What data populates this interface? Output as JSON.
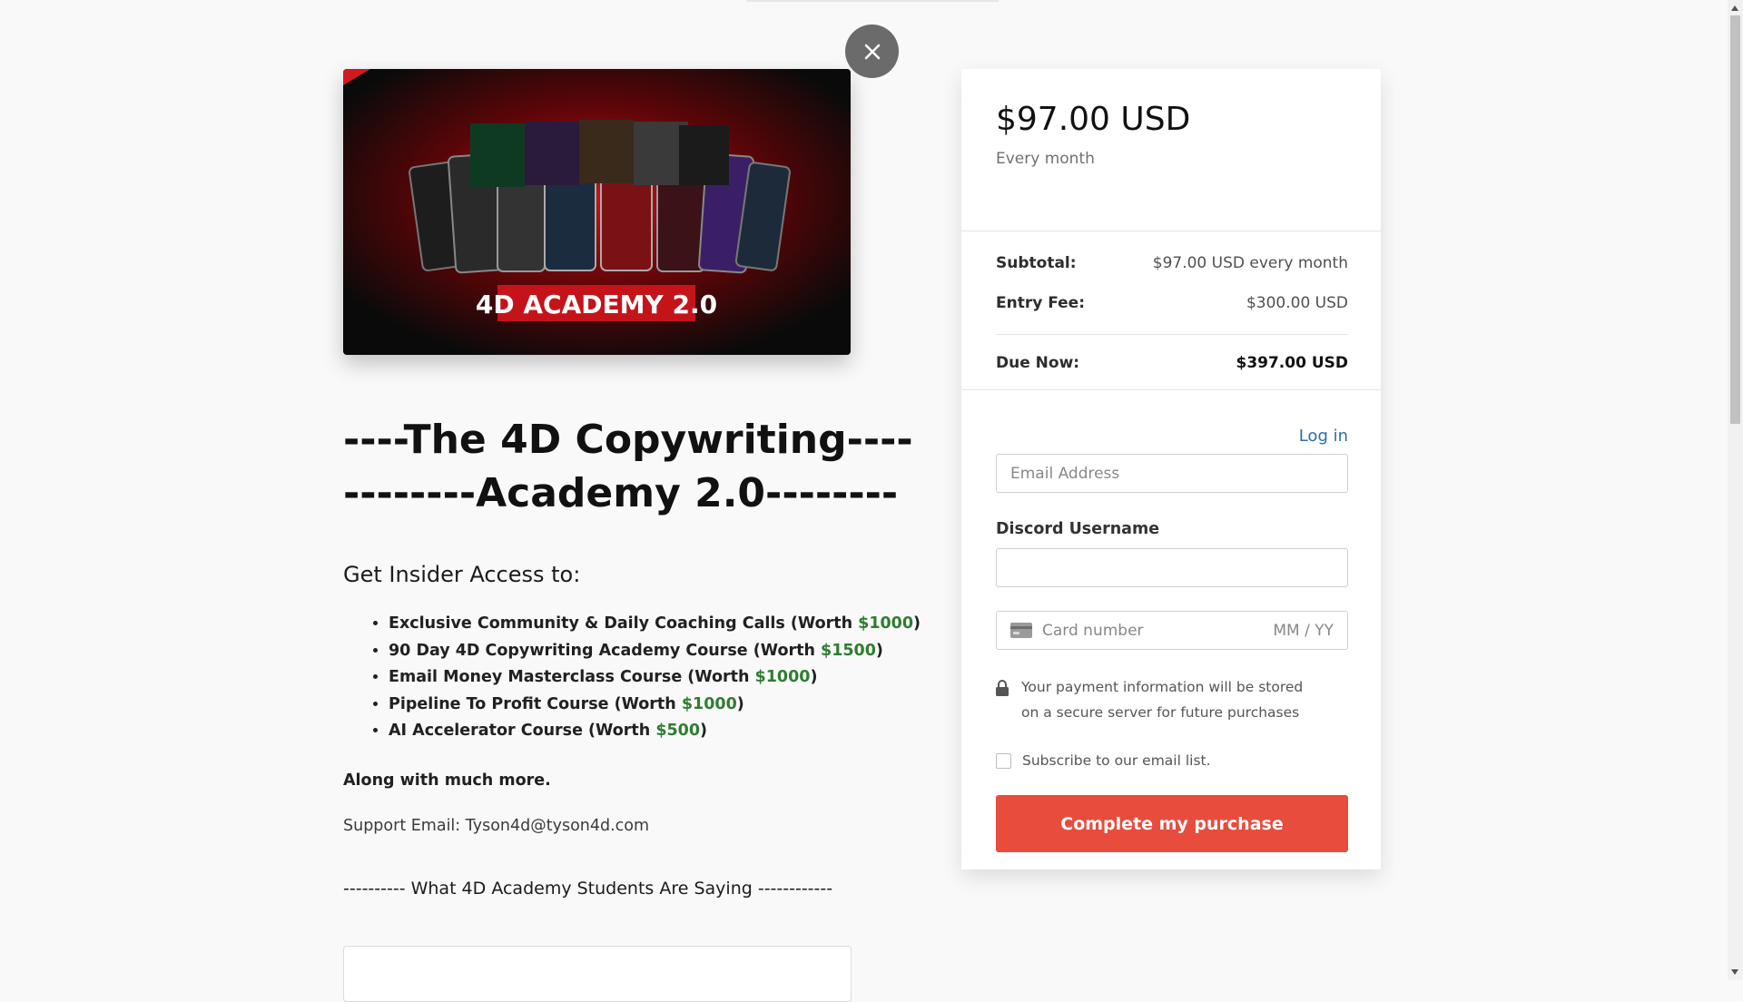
{
  "colors": {
    "accent_button": "#e84c3d",
    "link": "#2c6ea4",
    "worth_green": "#2e7d32",
    "close_button": "#6b6b6b"
  },
  "icons": {
    "close": "close-icon",
    "card": "credit-card-icon",
    "lock": "lock-icon"
  },
  "product": {
    "image_caption": "4D ACADEMY 2.0",
    "title_line1": "----The 4D Copywriting----",
    "title_line2": "--------Academy 2.0--------",
    "subheading": "Get Insider Access to:",
    "features": [
      {
        "text": "Exclusive Community & Daily Coaching Calls (Worth ",
        "price": "$1000",
        "suffix": ")"
      },
      {
        "text": "90 Day 4D Copywriting Academy Course (Worth ",
        "price": "$1500",
        "suffix": ")"
      },
      {
        "text": "Email Money Masterclass Course (Worth ",
        "price": "$1000",
        "suffix": ")"
      },
      {
        "text": "Pipeline To Profit Course (Worth ",
        "price": "$1000",
        "suffix": ")"
      },
      {
        "text": "AI Accelerator Course (Worth ",
        "price": "$500",
        "suffix": ")"
      }
    ],
    "more": "Along with much more.",
    "support": "Support Email: Tyson4d@tyson4d.com",
    "testimonials_heading": "---------- What 4D Academy Students Are Saying ------------"
  },
  "checkout": {
    "price": "$97.00 USD",
    "period": "Every month",
    "subtotal_label": "Subtotal:",
    "subtotal_value": "$97.00 USD every month",
    "entry_fee_label": "Entry Fee:",
    "entry_fee_value": "$300.00 USD",
    "due_label": "Due Now:",
    "due_value": "$397.00 USD",
    "login": "Log in",
    "email_placeholder": "Email Address",
    "discord_label": "Discord Username",
    "discord_value": "",
    "card_placeholder": "Card number",
    "expiry_placeholder": "MM / YY",
    "secure_note": "Your payment information will be stored on a secure server for future purchases",
    "subscribe_label": "Subscribe to our email list.",
    "subscribe_checked": false,
    "purchase_button": "Complete my purchase"
  }
}
